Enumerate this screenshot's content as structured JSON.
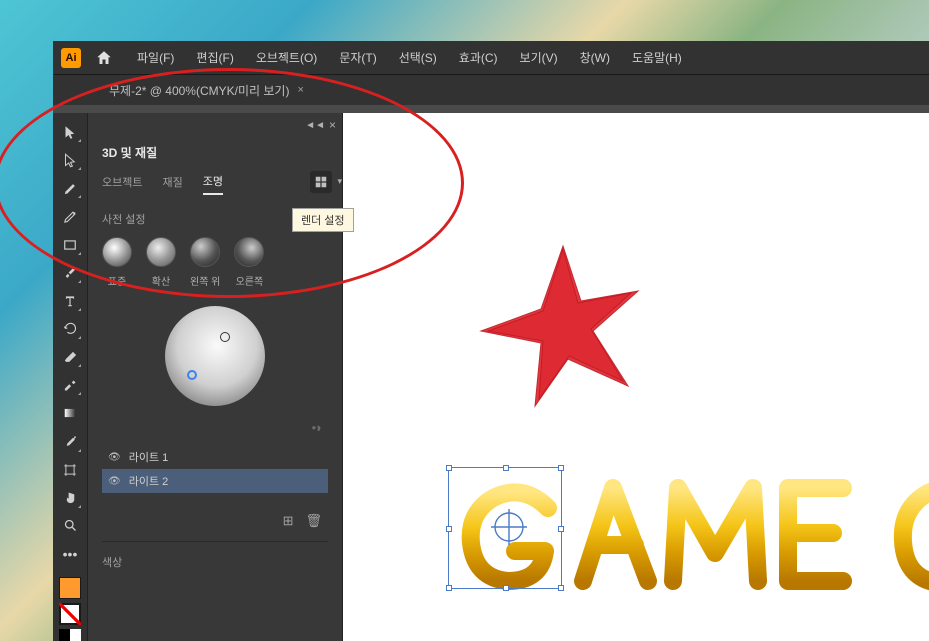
{
  "titlebar": {
    "app_short": "Ai"
  },
  "menubar": {
    "file": "파일(F)",
    "edit": "편집(F)",
    "object": "오브젝트(O)",
    "type": "문자(T)",
    "select": "선택(S)",
    "effect": "효과(C)",
    "view": "보기(V)",
    "window": "창(W)",
    "help": "도움말(H)"
  },
  "doc_tab": {
    "label": "무제-2* @ 400%(CMYK/미리 보기)",
    "close": "×"
  },
  "panel": {
    "title": "3D 및 재질",
    "tabs": {
      "object": "오브젝트",
      "material": "재질",
      "lighting": "조명"
    },
    "tooltip_render": "렌더 설정",
    "preset_label": "사전 설정",
    "presets": {
      "standard": "표준",
      "diffuse": "확산",
      "top_left": "왼쪽 위",
      "right": "오른쪽"
    },
    "lights": {
      "light1": "라이트 1",
      "light2": "라이트 2"
    },
    "color_section_label": "색상"
  },
  "canvas": {
    "text_content": "GAME CL"
  }
}
